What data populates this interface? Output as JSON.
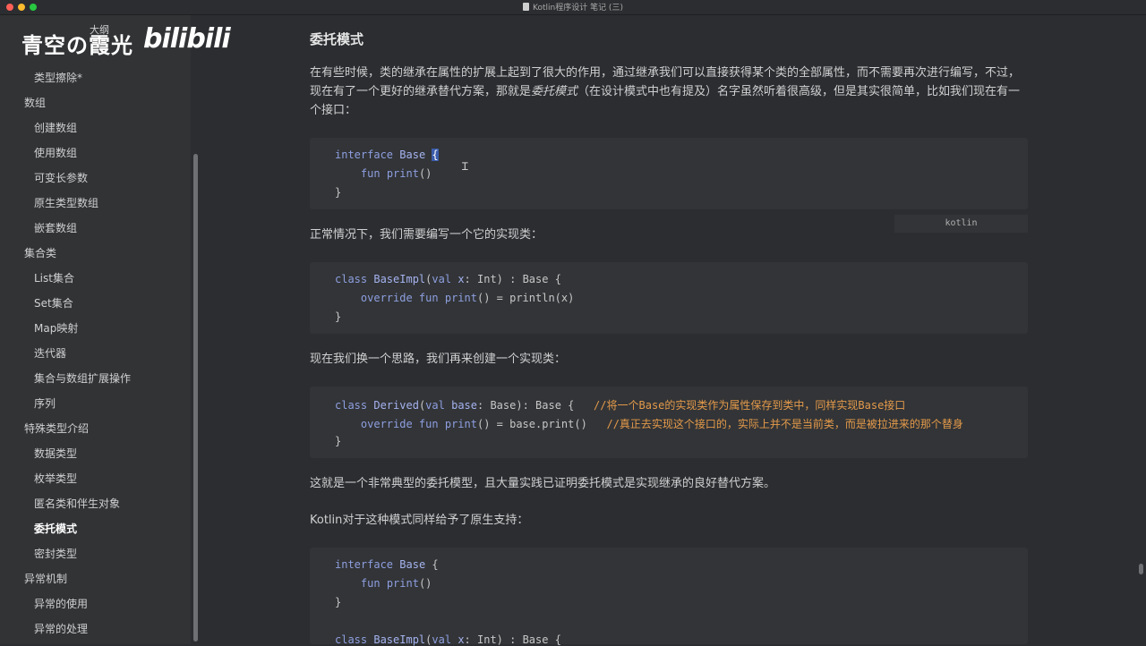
{
  "window": {
    "title": "Kotlin程序设计 笔记 (三)"
  },
  "watermark": {
    "text": "青空の霞光",
    "logo": "bilibili",
    "outline_label": "大纲"
  },
  "sidebar": {
    "items": [
      {
        "label": "类型擦除*",
        "level": 2
      },
      {
        "label": "数组",
        "level": 1
      },
      {
        "label": "创建数组",
        "level": 2
      },
      {
        "label": "使用数组",
        "level": 2
      },
      {
        "label": "可变长参数",
        "level": 2
      },
      {
        "label": "原生类型数组",
        "level": 2
      },
      {
        "label": "嵌套数组",
        "level": 2
      },
      {
        "label": "集合类",
        "level": 1
      },
      {
        "label": "List集合",
        "level": 2
      },
      {
        "label": "Set集合",
        "level": 2
      },
      {
        "label": "Map映射",
        "level": 2
      },
      {
        "label": "迭代器",
        "level": 2
      },
      {
        "label": "集合与数组扩展操作",
        "level": 2
      },
      {
        "label": "序列",
        "level": 2
      },
      {
        "label": "特殊类型介绍",
        "level": 1
      },
      {
        "label": "数据类型",
        "level": 2
      },
      {
        "label": "枚举类型",
        "level": 2
      },
      {
        "label": "匿名类和伴生对象",
        "level": 2
      },
      {
        "label": "委托模式",
        "level": 2,
        "active": true
      },
      {
        "label": "密封类型",
        "level": 2
      },
      {
        "label": "异常机制",
        "level": 1
      },
      {
        "label": "异常的使用",
        "level": 2
      },
      {
        "label": "异常的处理",
        "level": 2
      }
    ]
  },
  "article": {
    "heading": "委托模式",
    "intro_part1": "在有些时候，类的继承在属性的扩展上起到了很大的作用，通过继承我们可以直接获得某个类的全部属性，而不需要再次进行编写，不过，现在有了一个更好的继承替代方案，那就是",
    "intro_em": "委托模式",
    "intro_part2": "（在设计模式中也有提及）名字虽然听着很高级，但是其实很简单，比如我们现在有一个接口：",
    "code1": {
      "lang": "kotlin",
      "line1_kw": "interface",
      "line1_type": "Base",
      "line1_brace": "{",
      "line2_kw": "fun",
      "line2_fn": "print",
      "line2_rest": "()",
      "line3": "}"
    },
    "para2": "正常情况下，我们需要编写一个它的实现类：",
    "code2": {
      "line1_kw": "class",
      "line1_type": "BaseImpl",
      "line1_p1": "(",
      "line1_kw2": "val",
      "line1_var": "x",
      "line1_rest": ": Int) : Base {",
      "line2_kw": "override fun",
      "line2_fn": "print",
      "line2_rest": "() = println(x)",
      "line3": "}"
    },
    "para3": "现在我们换一个思路，我们再来创建一个实现类：",
    "code3": {
      "line1_kw": "class",
      "line1_type": "Derived",
      "line1_p1": "(",
      "line1_kw2": "val",
      "line1_var": "base",
      "line1_rest": ": Base): Base {   ",
      "line1_comment": "//将一个Base的实现类作为属性保存到类中，同样实现Base接口",
      "line2_kw": "override fun",
      "line2_fn": "print",
      "line2_rest": "() = base.print()   ",
      "line2_comment": "//真正去实现这个接口的，实际上并不是当前类，而是被拉进来的那个替身",
      "line3": "}"
    },
    "para4": "这就是一个非常典型的委托模型，且大量实践已证明委托模式是实现继承的良好替代方案。",
    "para5": "Kotlin对于这种模式同样给予了原生支持：",
    "code4": {
      "line1_kw": "interface",
      "line1_type": "Base",
      "line1_brace": " {",
      "line2_kw": "fun",
      "line2_fn": "print",
      "line2_rest": "()",
      "line3": "}",
      "line5_kw": "class",
      "line5_type": "BaseImpl",
      "line5_p1": "(",
      "line5_kw2": "val",
      "line5_var": "x",
      "line5_rest": ": Int) : Base {"
    }
  },
  "colors": {
    "background": "#2b2d30",
    "sidebar": "#313335",
    "code_bg": "#323437",
    "keyword": "#8e9fe0",
    "comment": "#e49a4a"
  }
}
